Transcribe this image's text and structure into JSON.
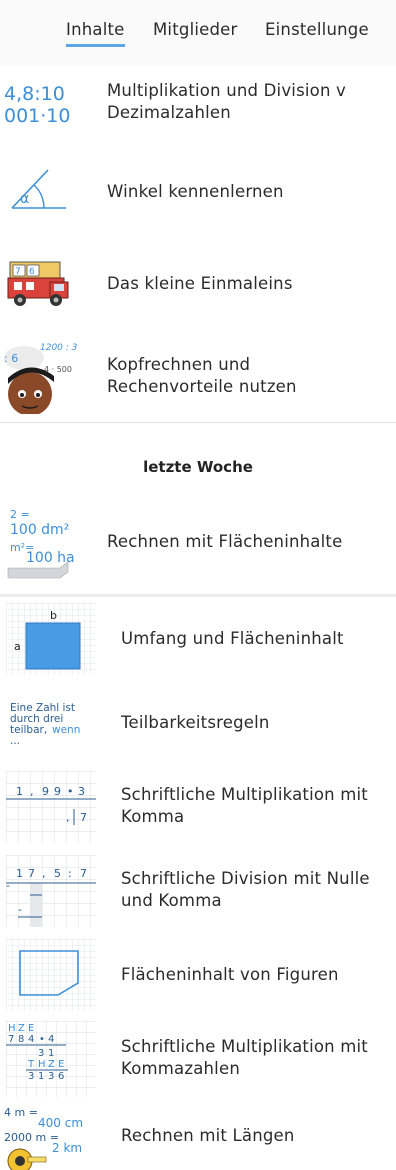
{
  "tabs": {
    "content": "Inhalte",
    "members": "Mitglieder",
    "settings": "Einstellunge"
  },
  "items_top": [
    {
      "title": "Multiplikation und Division v\nDezimalzahlen",
      "thumb": {
        "line1": "4,8:10",
        "line2": "001·10"
      }
    },
    {
      "title": "Winkel kennenlernen",
      "thumb": {
        "angle": "α"
      }
    },
    {
      "title": "Das kleine Einmaleins",
      "thumb": {
        "d1": "7",
        "d2": "6"
      }
    },
    {
      "title": "Kopfrechnen und\nRechenvorteile nutzen",
      "thumb": {
        "t1": "1200 : 3",
        "t2": ": 6",
        "t3": "4 · 500"
      }
    }
  ],
  "section_label": "letzte Woche",
  "items_week": [
    {
      "title": "Rechnen mit Flächeninhalte",
      "thumb": {
        "l1": "2 =",
        "l2": "100 dm²",
        "l3": "m²=",
        "l4": "100 ha"
      }
    },
    {
      "title": "Umfang und Flächeninhalt",
      "thumb": {
        "b": "b",
        "a": "a"
      }
    },
    {
      "title": "Teilbarkeitsregeln",
      "thumb": {
        "l1": "Eine Zahl ist",
        "l2": "durch drei",
        "l3": "teilbar,",
        "l3b": "wenn",
        "l4": "..."
      }
    },
    {
      "title": "Schriftliche Multiplikation mit\nKomma",
      "thumb": {
        "row1": [
          "1",
          ",",
          "9",
          "9",
          "•",
          "3"
        ],
        "row2": [
          ",",
          "7"
        ]
      }
    },
    {
      "title": "Schriftliche Division mit Nulle\nund Komma",
      "thumb": {
        "row1": [
          "1",
          "7",
          ",",
          "5",
          ":",
          "7"
        ],
        "minus": "-"
      }
    },
    {
      "title": "Flächeninhalt von Figuren",
      "thumb": {}
    },
    {
      "title": "Schriftliche Multiplikation mit\nKommazahlen",
      "thumb": {
        "h1": [
          "H",
          "Z",
          "E"
        ],
        "r1": [
          "7",
          "8",
          "4",
          "•",
          "4"
        ],
        "r2": [
          "3",
          "1"
        ],
        "h2": [
          "T",
          "H",
          "Z",
          "E"
        ],
        "r3": [
          "3",
          "1",
          "3",
          "6"
        ]
      }
    },
    {
      "title": "Rechnen mit Längen",
      "thumb": {
        "l1": "4 m =",
        "l2": "400 cm",
        "l3": "2000 m =",
        "l4": "2 km"
      }
    }
  ],
  "colors": {
    "accent": "#5aa6e6",
    "math_blue": "#3d8fd6",
    "text": "#2b2b2b",
    "divider": "#e2e2e2"
  }
}
